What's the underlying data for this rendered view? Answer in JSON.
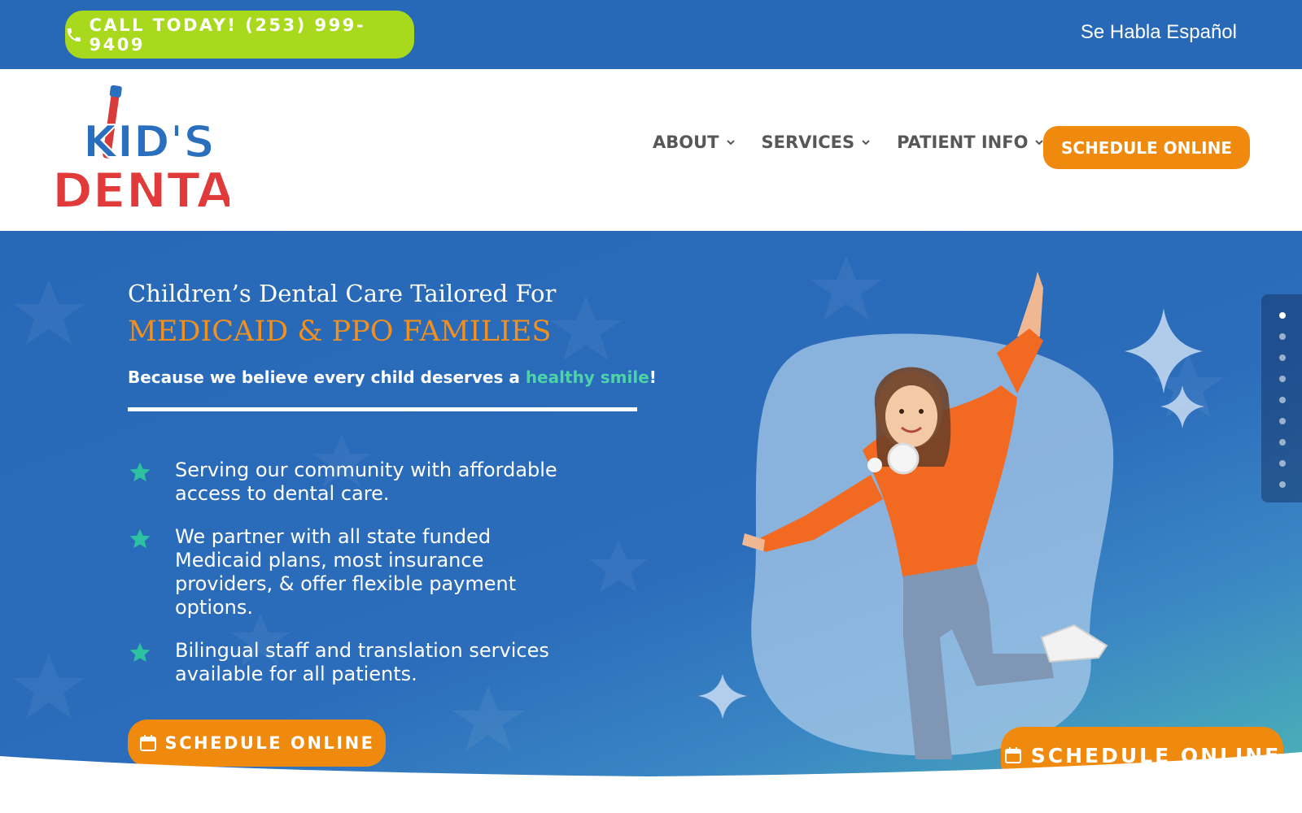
{
  "topbar": {
    "call_label": "CALL TODAY! (253) 999-9409",
    "language_label": "Se Habla Español"
  },
  "header": {
    "logo_text_1": "KID'S",
    "logo_text_2": "DENTAL",
    "nav": [
      {
        "label": "ABOUT"
      },
      {
        "label": "SERVICES"
      },
      {
        "label": "PATIENT INFO"
      }
    ],
    "schedule_label": "SCHEDULE ONLINE"
  },
  "hero": {
    "title": "Children’s Dental Care Tailored For",
    "subtitle": "MEDICAID & PPO FAMILIES",
    "tagline_pre": "Because we believe every child deserves a ",
    "tagline_highlight": "healthy smile",
    "tagline_post": "!",
    "features": [
      {
        "text": "Serving our community with affordable access to dental care."
      },
      {
        "text": "We partner with all state funded Medicaid plans, most insurance providers, & offer flexible payment options."
      },
      {
        "text": "Bilingual staff and translation services available for all patients."
      }
    ],
    "schedule_label": "SCHEDULE ONLINE",
    "float_schedule_label": "SCHEDULE ONLINE"
  },
  "slider": {
    "dot_count": 9,
    "active_index": 0
  },
  "colors": {
    "brand_blue": "#2768b7",
    "call_green": "#a8d91d",
    "accent_orange": "#f08a0e",
    "highlight_teal": "#4ed3a8"
  },
  "icons": {
    "call": "phone-icon",
    "nav_dropdown": "chevron-down-icon",
    "feature_bullet": "star-icon",
    "schedule": "calendar-icon"
  }
}
